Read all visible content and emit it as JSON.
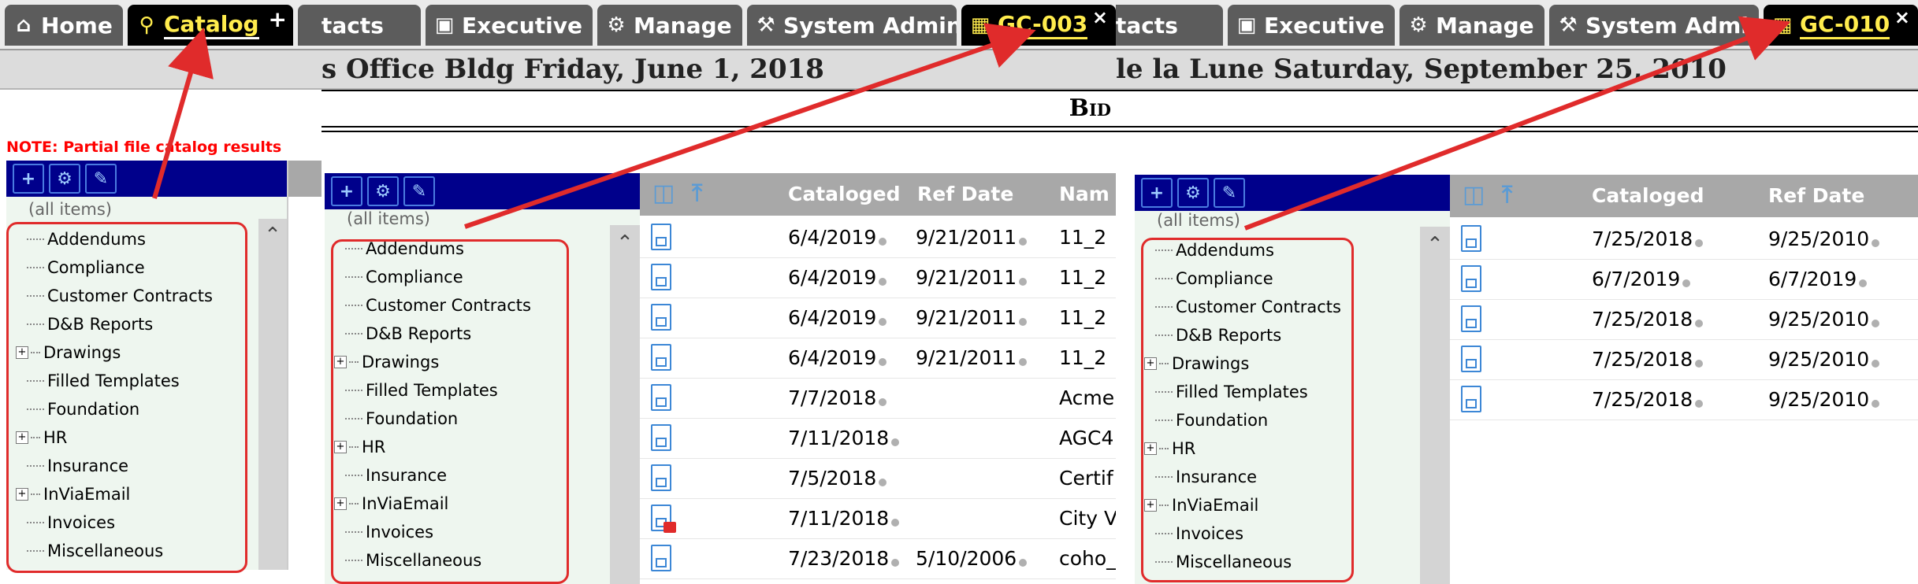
{
  "panel1": {
    "tabs": {
      "home": "Home",
      "catalog": "Catalog",
      "add": "+"
    },
    "note": "NOTE: Partial file catalog results",
    "tree_all": "(all items)",
    "tree_items": [
      {
        "label": "Addendums",
        "expandable": false
      },
      {
        "label": "Compliance",
        "expandable": false
      },
      {
        "label": "Customer Contracts",
        "expandable": false
      },
      {
        "label": "D&B Reports",
        "expandable": false
      },
      {
        "label": "Drawings",
        "expandable": true
      },
      {
        "label": "Filled Templates",
        "expandable": false
      },
      {
        "label": "Foundation",
        "expandable": false
      },
      {
        "label": "HR",
        "expandable": true
      },
      {
        "label": "Insurance",
        "expandable": false
      },
      {
        "label": "InViaEmail",
        "expandable": true
      },
      {
        "label": "Invoices",
        "expandable": false
      },
      {
        "label": "Miscellaneous",
        "expandable": false
      }
    ]
  },
  "panel2": {
    "tabs": {
      "contacts": "ntacts",
      "executive": "Executive",
      "manage": "Manage",
      "sysadmin": "System Admin",
      "gc": "GC-003",
      "close": "×"
    },
    "subtitle": "s Office Bldg Friday, June 1, 2018",
    "bid": "Bid",
    "tree_all": "(all items)",
    "tree_items": [
      {
        "label": "Addendums",
        "expandable": false
      },
      {
        "label": "Compliance",
        "expandable": false
      },
      {
        "label": "Customer Contracts",
        "expandable": false
      },
      {
        "label": "D&B Reports",
        "expandable": false
      },
      {
        "label": "Drawings",
        "expandable": true
      },
      {
        "label": "Filled Templates",
        "expandable": false
      },
      {
        "label": "Foundation",
        "expandable": false
      },
      {
        "label": "HR",
        "expandable": true
      },
      {
        "label": "Insurance",
        "expandable": false
      },
      {
        "label": "InViaEmail",
        "expandable": true
      },
      {
        "label": "Invoices",
        "expandable": false
      },
      {
        "label": "Miscellaneous",
        "expandable": false
      }
    ],
    "columns": {
      "cataloged": "Cataloged",
      "refdate": "Ref Date",
      "name": "Nam"
    },
    "rows": [
      {
        "cataloged": "6/4/2019",
        "refdate": "9/21/2011",
        "name": "11_2",
        "locked": false
      },
      {
        "cataloged": "6/4/2019",
        "refdate": "9/21/2011",
        "name": "11_2",
        "locked": false
      },
      {
        "cataloged": "6/4/2019",
        "refdate": "9/21/2011",
        "name": "11_2",
        "locked": false
      },
      {
        "cataloged": "6/4/2019",
        "refdate": "9/21/2011",
        "name": "11_2",
        "locked": false
      },
      {
        "cataloged": "7/7/2018",
        "refdate": "",
        "name": "Acme",
        "locked": false
      },
      {
        "cataloged": "7/11/2018",
        "refdate": "",
        "name": "AGC4",
        "locked": false
      },
      {
        "cataloged": "7/5/2018",
        "refdate": "",
        "name": "Certif",
        "locked": false
      },
      {
        "cataloged": "7/11/2018",
        "refdate": "",
        "name": "City V",
        "locked": true
      },
      {
        "cataloged": "7/23/2018",
        "refdate": "5/10/2006",
        "name": "coho_",
        "locked": false
      }
    ]
  },
  "panel3": {
    "tabs": {
      "contacts": "ntacts",
      "executive": "Executive",
      "manage": "Manage",
      "sysadmin": "System Admin",
      "gc": "GC-010",
      "close": "×"
    },
    "subtitle": "le la Lune Saturday, September 25, 2010",
    "tree_all": "(all items)",
    "tree_items": [
      {
        "label": "Addendums",
        "expandable": false
      },
      {
        "label": "Compliance",
        "expandable": false
      },
      {
        "label": "Customer Contracts",
        "expandable": false
      },
      {
        "label": "D&B Reports",
        "expandable": false
      },
      {
        "label": "Drawings",
        "expandable": true
      },
      {
        "label": "Filled Templates",
        "expandable": false
      },
      {
        "label": "Foundation",
        "expandable": false
      },
      {
        "label": "HR",
        "expandable": true
      },
      {
        "label": "Insurance",
        "expandable": false
      },
      {
        "label": "InViaEmail",
        "expandable": true
      },
      {
        "label": "Invoices",
        "expandable": false
      },
      {
        "label": "Miscellaneous",
        "expandable": false
      }
    ],
    "columns": {
      "cataloged": "Cataloged",
      "refdate": "Ref Date"
    },
    "rows": [
      {
        "cataloged": "7/25/2018",
        "refdate": "9/25/2010",
        "locked": false
      },
      {
        "cataloged": "6/7/2019",
        "refdate": "6/7/2019",
        "locked": false
      },
      {
        "cataloged": "7/25/2018",
        "refdate": "9/25/2010",
        "locked": false
      },
      {
        "cataloged": "7/25/2018",
        "refdate": "9/25/2010",
        "locked": false
      },
      {
        "cataloged": "7/25/2018",
        "refdate": "9/25/2010",
        "locked": false
      }
    ]
  },
  "colors": {
    "annotation_red": "#e02b2b",
    "navy_toolbar": "#00008b",
    "tab_gray": "#5c5c5c",
    "active_tab_text": "#ffec4d"
  }
}
